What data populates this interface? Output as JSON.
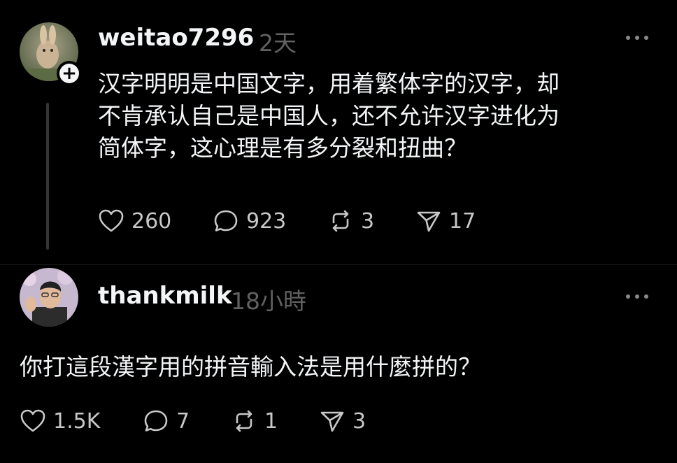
{
  "posts": [
    {
      "username": "weitao7296",
      "time": "2天",
      "lines": [
        "汉字明明是中国文字，用着繁体字的汉字，却",
        "不肯承认自己是中国人，还不允许汉字进化为",
        "简体字，这心理是有多分裂和扭曲？"
      ],
      "likes": "260",
      "replies": "923",
      "reposts": "3",
      "shares": "17"
    },
    {
      "username": "thankmilk",
      "time": "18小時",
      "lines": [
        "你打這段漢字用的拼音輸入法是用什麼拼的？"
      ],
      "likes": "1.5K",
      "replies": "7",
      "reposts": "1",
      "shares": "3"
    }
  ],
  "icons": {
    "like": "heart-icon",
    "reply": "comment-icon",
    "repost": "repost-icon",
    "share": "share-icon",
    "more": "more-icon",
    "follow": "plus-icon"
  },
  "colors": {
    "background": "#000000",
    "text": "#f3f5f7",
    "muted": "#616161"
  }
}
